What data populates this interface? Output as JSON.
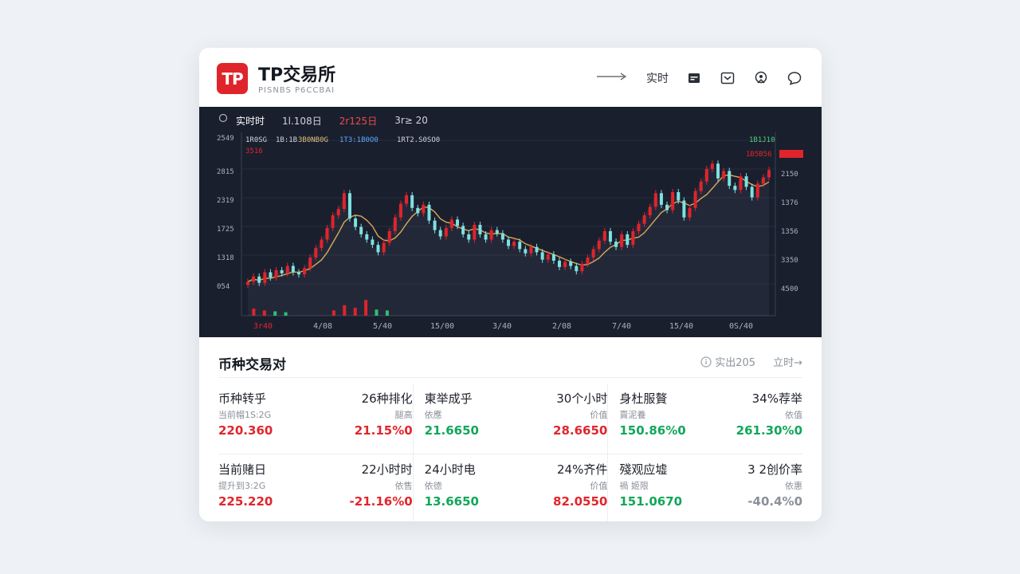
{
  "app": {
    "logo_text": "TP",
    "name": "TP交易所",
    "subtitle": "PISNBS P6CCBAI"
  },
  "header": {
    "realtime_label": "实时",
    "icons": [
      "arrow-right-icon",
      "card-icon",
      "inbox-icon",
      "user-icon",
      "chat-icon"
    ]
  },
  "chart_tabs": [
    "实时时",
    "1l.108日",
    "2r125日",
    "3r≥ 20"
  ],
  "chart_overlay": {
    "legend": [
      "1R0SG",
      "1B:1B",
      "3B0NB0G",
      "1T3:1B0O0",
      "1RT2.S0SO0"
    ],
    "sub_legend": "3516",
    "right_top": "1B1J10",
    "right_sub": "1B5B56"
  },
  "chart_data": {
    "type": "candlestick",
    "y_left_ticks": [
      "2549",
      "2815",
      "2319",
      "1725",
      "1318",
      "054"
    ],
    "y_right_ticks": [
      "2150",
      "1376",
      "1356",
      "3350",
      "4500"
    ],
    "x_ticks": [
      "3r40",
      "4/08",
      "5/40",
      "15/00",
      "3/40",
      "2/08",
      "7/40",
      "15/40",
      "0S/40"
    ],
    "close_series": [
      14.1,
      14.6,
      14.0,
      15.0,
      14.5,
      15.2,
      14.9,
      15.6,
      15.0,
      14.8,
      15.4,
      16.4,
      17.3,
      18.1,
      19.2,
      20.4,
      21.0,
      22.5,
      20.1,
      19.3,
      18.6,
      18.1,
      17.6,
      16.9,
      17.8,
      18.9,
      20.2,
      21.5,
      22.3,
      21.1,
      20.6,
      21.4,
      19.9,
      19.0,
      18.4,
      19.2,
      20.0,
      19.4,
      18.6,
      18.1,
      19.5,
      18.6,
      18.1,
      19.0,
      18.7,
      18.1,
      17.5,
      17.9,
      17.2,
      16.8,
      17.4,
      16.9,
      16.2,
      16.7,
      16.1,
      15.5,
      16.0,
      15.6,
      15.1,
      15.8,
      16.4,
      17.2,
      18.0,
      18.9,
      17.9,
      17.4,
      18.6,
      17.6,
      18.9,
      19.6,
      20.4,
      21.2,
      22.5,
      21.4,
      20.9,
      22.6,
      21.8,
      20.2,
      21.1,
      22.7,
      23.6,
      24.8,
      25.3,
      23.9,
      24.6,
      23.2,
      22.8,
      24.1,
      23.1,
      22.1,
      23.4,
      24.0,
      24.7
    ],
    "volume_bars": [
      {
        "x": 0.02,
        "value": 0.4,
        "up": true
      },
      {
        "x": 0.04,
        "value": 0.3,
        "up": true
      },
      {
        "x": 0.06,
        "value": 0.25,
        "up": false
      },
      {
        "x": 0.08,
        "value": 0.2,
        "up": false
      },
      {
        "x": 0.17,
        "value": 0.3,
        "up": true
      },
      {
        "x": 0.19,
        "value": 0.6,
        "up": true
      },
      {
        "x": 0.21,
        "value": 0.45,
        "up": true
      },
      {
        "x": 0.23,
        "value": 0.9,
        "up": true
      },
      {
        "x": 0.25,
        "value": 0.35,
        "up": false
      },
      {
        "x": 0.27,
        "value": 0.3,
        "up": false
      }
    ]
  },
  "section": {
    "title": "币种交易对",
    "right_a": "实出205",
    "right_b": "立时→"
  },
  "stats": [
    [
      {
        "l_label": "币种转乎",
        "l_sub": "当前帽1S:2G",
        "l_val": "220.360",
        "l_color": "red",
        "r_label": "26种排化",
        "r_sub": "腿高",
        "r_val": "21.15%0",
        "r_color": "red"
      },
      {
        "l_label": "東举成乎",
        "l_sub": "依應",
        "l_val": "21.6650",
        "l_color": "green",
        "r_label": "30个小时",
        "r_sub": "价值",
        "r_val": "28.6650",
        "r_color": "red"
      },
      {
        "l_label": "身杜服贅",
        "l_sub": "賣泥養",
        "l_val": "150.86%0",
        "l_color": "green",
        "r_label": "34%荐举",
        "r_sub": "依值",
        "r_val": "261.30%0",
        "r_color": "green"
      }
    ],
    [
      {
        "l_label": "当前赌日",
        "l_sub": "提升到3:2G",
        "l_val": "225.220",
        "l_color": "red",
        "r_label": "22小时时",
        "r_sub": "依售",
        "r_val": "-21.16%0",
        "r_color": "red"
      },
      {
        "l_label": "24小时电",
        "l_sub": "依德",
        "l_val": "13.6650",
        "l_color": "green",
        "r_label": "24%齐件",
        "r_sub": "价值",
        "r_val": "82.0550",
        "r_color": "red"
      },
      {
        "l_label": "殘观应墟",
        "l_sub": "禍 姬限",
        "l_val": "151.0670",
        "l_color": "green",
        "r_label": "3 2创价率",
        "r_sub": "依惠",
        "r_val": "-40.4%0",
        "r_color": "gray"
      }
    ]
  ],
  "colors": {
    "up": "#e0242b",
    "down": "#7fe0e0",
    "ma": "#d9a857",
    "chart_bg": "#1a1f2e",
    "accent": "#e0242b",
    "green": "#12a65a"
  }
}
